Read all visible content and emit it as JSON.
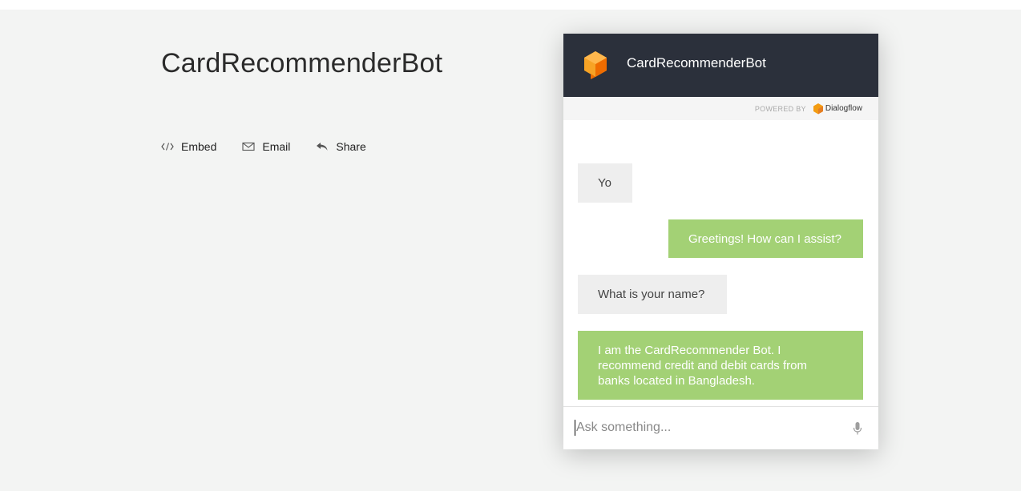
{
  "page": {
    "title": "CardRecommenderBot"
  },
  "actions": [
    {
      "label": "Embed",
      "icon": "code-icon"
    },
    {
      "label": "Email",
      "icon": "envelope-icon"
    },
    {
      "label": "Share",
      "icon": "reply-arrow-icon"
    }
  ],
  "chat": {
    "title": "CardRecommenderBot",
    "powered_by": "POWERED BY",
    "brand": "Dialogflow",
    "input_placeholder": "Ask something...",
    "messages": [
      {
        "from": "user",
        "text": "Yo"
      },
      {
        "from": "bot",
        "text": "Greetings! How can I assist?"
      },
      {
        "from": "user",
        "text": "What is your name?"
      },
      {
        "from": "bot",
        "text": "I am the CardRecommender Bot. I recommend credit and debit cards from banks located in Bangladesh."
      }
    ]
  },
  "colors": {
    "header": "#2b303b",
    "bot_bubble": "#a3d175",
    "user_bubble": "#eeeeee",
    "accent_orange": "#f39c12"
  }
}
